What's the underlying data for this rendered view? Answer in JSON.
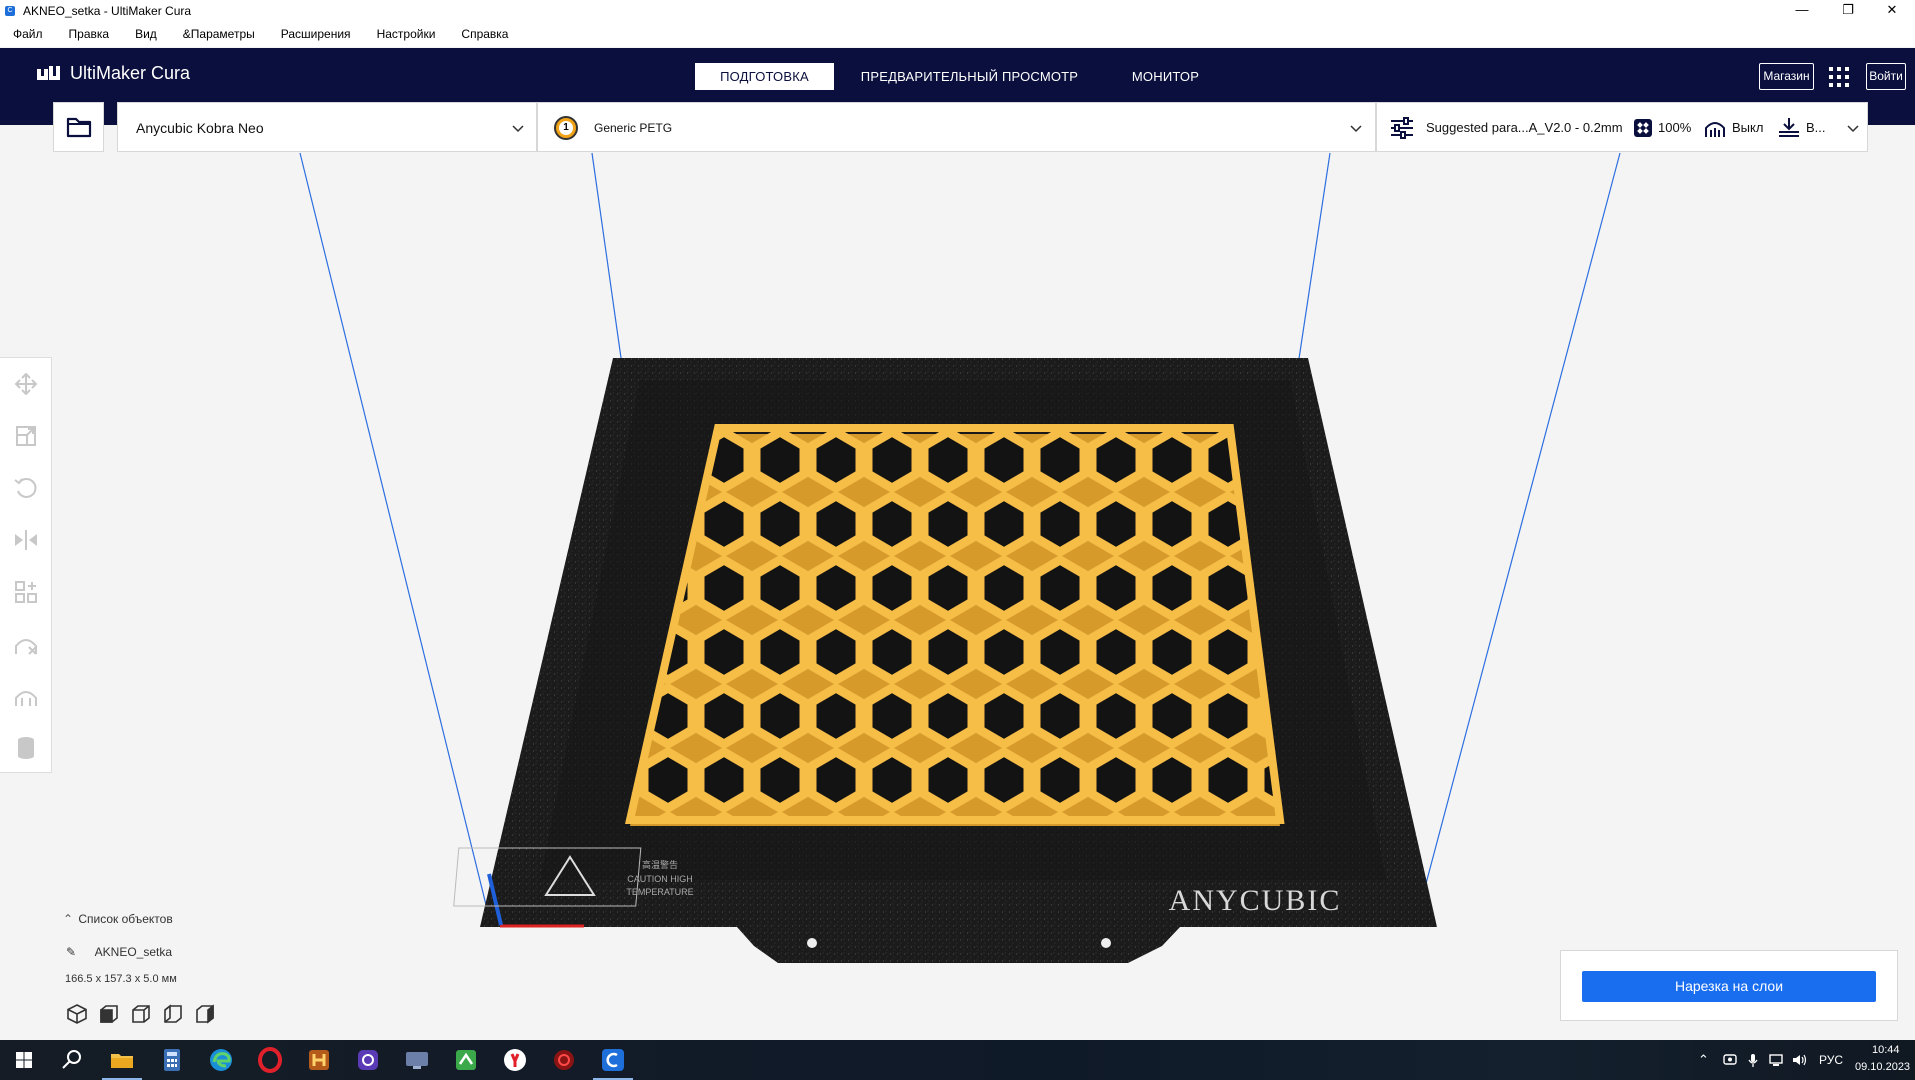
{
  "window": {
    "title": "AKNEO_setka - UltiMaker Cura",
    "app_icon_letter": "C",
    "minimize_glyph": "—",
    "restore_glyph": "❐",
    "close_glyph": "✕"
  },
  "menu": {
    "items": [
      "Файл",
      "Правка",
      "Вид",
      "&Параметры",
      "Расширения",
      "Настройки",
      "Справка"
    ]
  },
  "header": {
    "logo_text": "UltiMaker Cura",
    "tabs": [
      {
        "label": "ПОДГОТОВКА",
        "active": true
      },
      {
        "label": "ПРЕДВАРИТЕЛЬНЫЙ ПРОСМОТР",
        "active": false
      },
      {
        "label": "МОНИТОР",
        "active": false
      }
    ],
    "marketplace_label": "Магазин",
    "signin_label": "Войти",
    "colors": {
      "header_bg": "#0a0f3d",
      "accent": "#196ef0",
      "model": "#f4b941"
    }
  },
  "job": {
    "printer": "Anycubic Kobra Neo",
    "material_number": "1",
    "material": "Generic PETG",
    "profile": "Suggested para...A_V2.0 - 0.2mm",
    "infill": "100%",
    "support": "Выкл",
    "adhesion": "В..."
  },
  "viewport": {
    "bed_brand": "ANYCUBIC",
    "bed_warning_lines": [
      "高温警告",
      "CAUTION HIGH",
      "TEMPERATURE"
    ]
  },
  "object_list": {
    "header": "Список объектов",
    "object_name": "AKNEO_setka",
    "dimensions": "166.5 x 157.3 x 5.0 мм"
  },
  "slice": {
    "button_label": "Нарезка на слои"
  },
  "taskbar": {
    "language": "РУС",
    "time": "10:44",
    "date": "09.10.2023"
  }
}
